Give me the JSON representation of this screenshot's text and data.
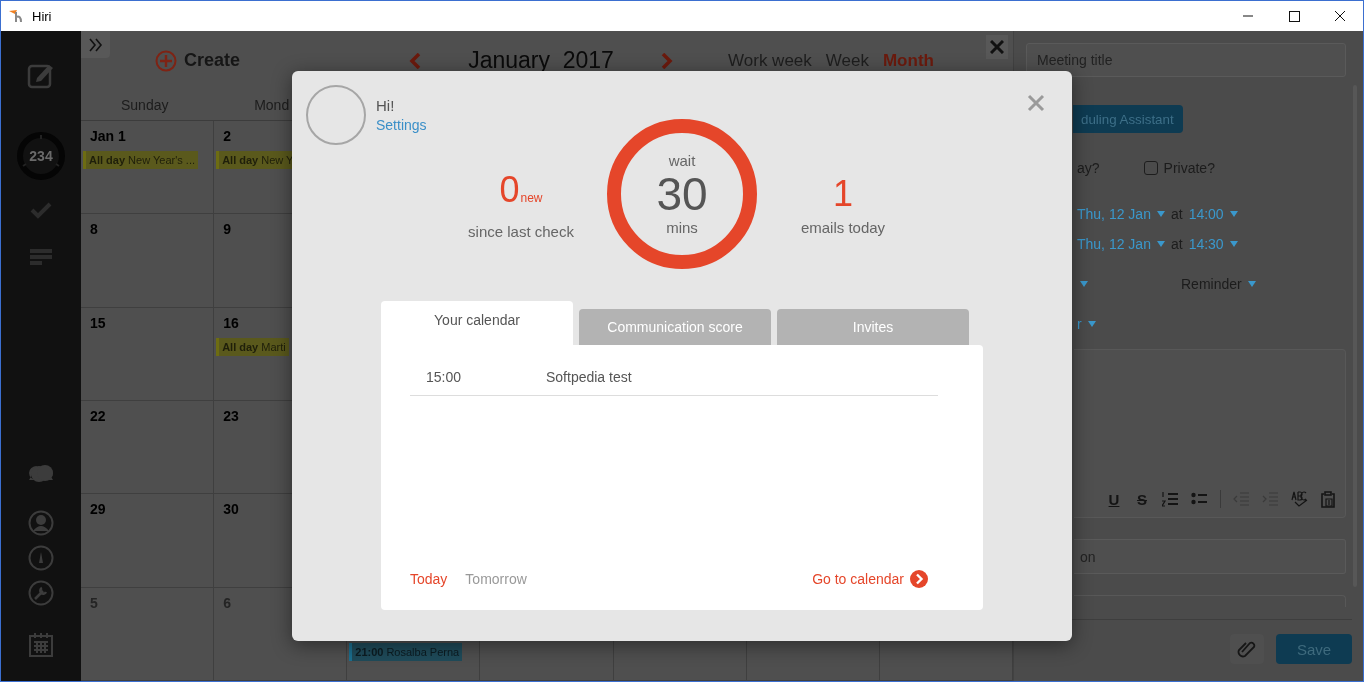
{
  "window": {
    "title": "Hiri"
  },
  "sidebar": {
    "unread_count": "234"
  },
  "calendar": {
    "create_label": "Create",
    "month_title": "January  2017",
    "views": [
      {
        "label": "Work week",
        "selected": false
      },
      {
        "label": "Week",
        "selected": false
      },
      {
        "label": "Month",
        "selected": true
      }
    ],
    "day_headers": [
      "Sunday",
      "Mond"
    ],
    "weeks": [
      {
        "cells": [
          {
            "day": "Jan 1",
            "muted": false,
            "events": [
              {
                "kind": "all_day",
                "time": "All day",
                "title": "New Year's ..."
              }
            ]
          },
          {
            "day": "2",
            "muted": false,
            "events": [
              {
                "kind": "all_day",
                "time": "All day",
                "title": "New Y"
              }
            ]
          }
        ]
      },
      {
        "cells": [
          {
            "day": "8",
            "muted": false
          },
          {
            "day": "9",
            "muted": false
          }
        ]
      },
      {
        "cells": [
          {
            "day": "15",
            "muted": false
          },
          {
            "day": "16",
            "muted": false,
            "events": [
              {
                "kind": "all_day",
                "time": "All day",
                "title": "Marti"
              }
            ]
          }
        ]
      },
      {
        "cells": [
          {
            "day": "22",
            "muted": false
          },
          {
            "day": "23",
            "muted": false
          }
        ]
      },
      {
        "cells": [
          {
            "day": "29",
            "muted": false
          },
          {
            "day": "30",
            "muted": false
          }
        ]
      },
      {
        "cells": [
          {
            "day": "5",
            "muted": true
          },
          {
            "day": "6",
            "muted": true
          },
          {
            "events": [
              {
                "kind": "timed",
                "time": "21:00",
                "title": "Rosalba Perna"
              }
            ]
          }
        ]
      }
    ]
  },
  "event_form": {
    "title_placeholder": "Meeting title",
    "assistant_button": "duling Assistant",
    "all_day_label": "ay?",
    "private": {
      "label": "Private?",
      "checked": false
    },
    "start": {
      "date": "Thu, 12 Jan",
      "at": "at",
      "time": "14:00"
    },
    "end": {
      "date": "Thu, 12 Jan",
      "at": "at",
      "time": "14:30"
    },
    "reminder_label": "Reminder",
    "row_label": "r",
    "toolbar": [
      {
        "kind": "underline",
        "label": "U"
      },
      {
        "kind": "strike",
        "label": "S"
      },
      {
        "kind": "numbered"
      },
      {
        "kind": "bulleted"
      },
      {
        "kind": "separator"
      },
      {
        "kind": "outdent"
      },
      {
        "kind": "indent"
      },
      {
        "kind": "spellcheck"
      },
      {
        "kind": "paste"
      }
    ],
    "location_placeholder": "on",
    "save_button": "Save"
  },
  "welcome_dialog": {
    "greeting": "Hi!",
    "settings_link": "Settings",
    "new_count": "0",
    "new_suffix": "new",
    "new_caption": "since last check",
    "timer": {
      "top": "wait",
      "value": "30",
      "unit": "mins"
    },
    "today_count": "1",
    "today_caption": "emails today",
    "tabs": [
      {
        "label": "Your calendar",
        "selected": true
      },
      {
        "label": "Communication score",
        "selected": false
      },
      {
        "label": "Invites",
        "selected": false
      }
    ],
    "events": [
      {
        "time": "15:00",
        "title": "Softpedia test"
      }
    ],
    "day_filters": [
      {
        "label": "Today",
        "selected": true
      },
      {
        "label": "Tomorrow",
        "selected": false
      }
    ],
    "go_link": "Go to calendar"
  }
}
